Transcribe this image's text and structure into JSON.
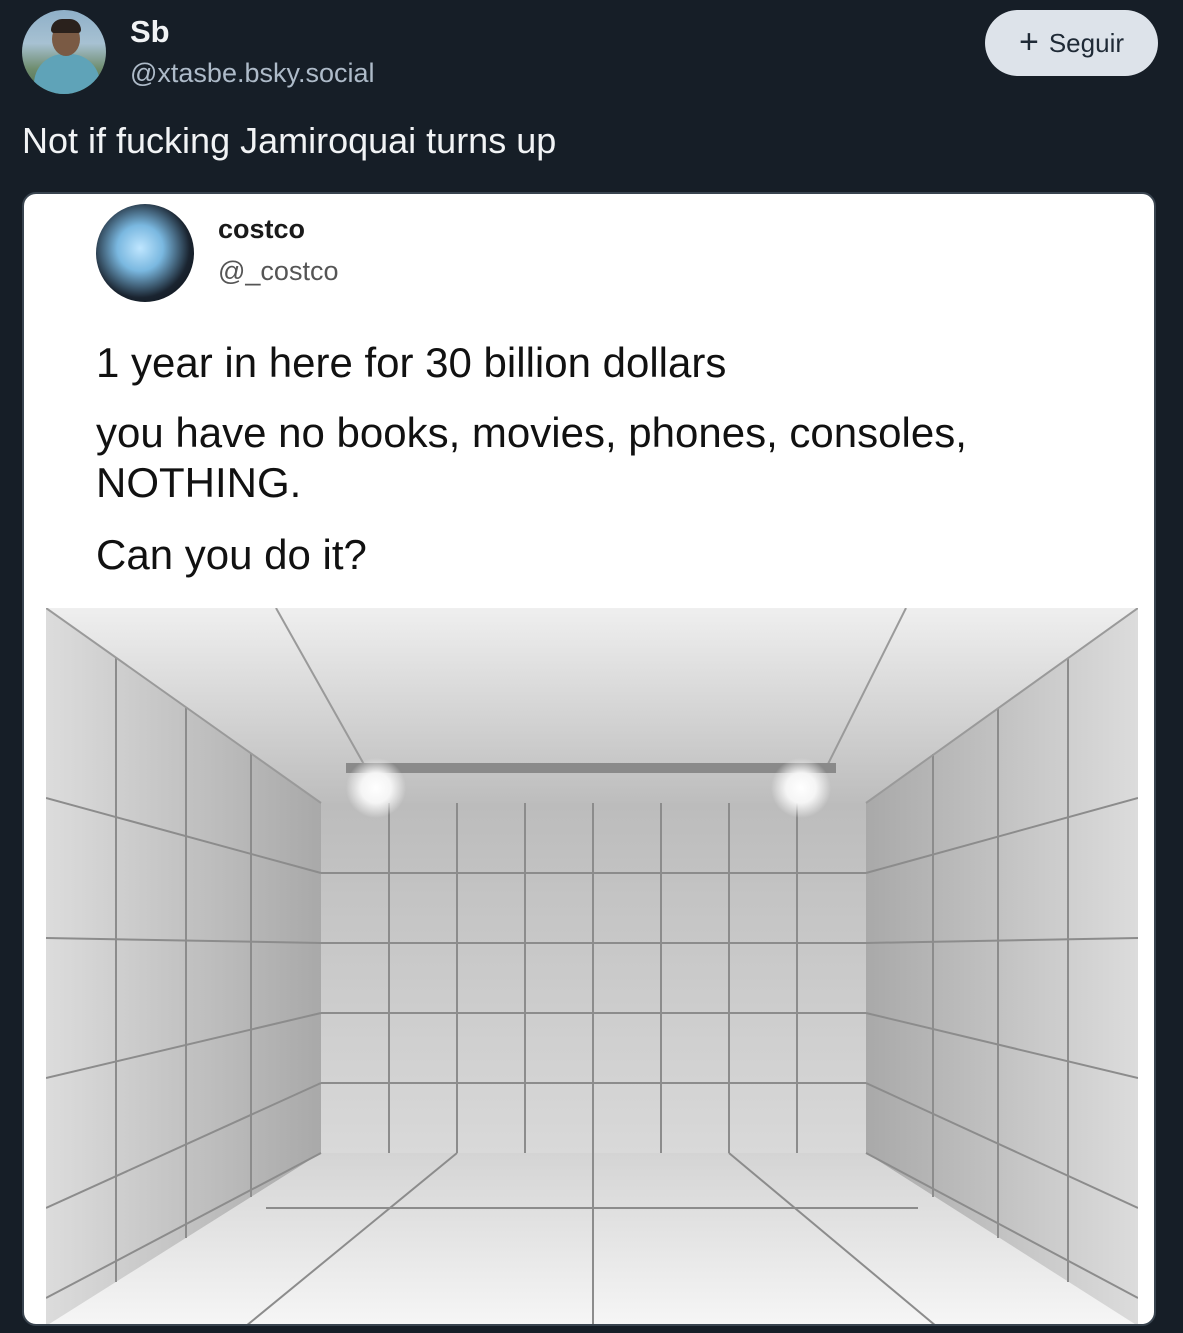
{
  "post": {
    "author": {
      "display_name": "Sb",
      "handle": "@xtasbe.bsky.social",
      "avatar_icon": "user-avatar"
    },
    "follow_button": {
      "icon": "plus-icon",
      "label": "Seguir"
    },
    "text": "Not if fucking Jamiroquai turns up"
  },
  "embed": {
    "author": {
      "name": "costco",
      "handle": "@_costco",
      "avatar_icon": "user-avatar"
    },
    "lines": [
      "1 year in here for 30 billion dollars",
      "you have no books, movies, phones, consoles,",
      "NOTHING.",
      "Can you do it?"
    ]
  },
  "colors": {
    "background": "#161e27",
    "follow_button_bg": "#dde3ea",
    "handle_text": "#aebbc9"
  }
}
